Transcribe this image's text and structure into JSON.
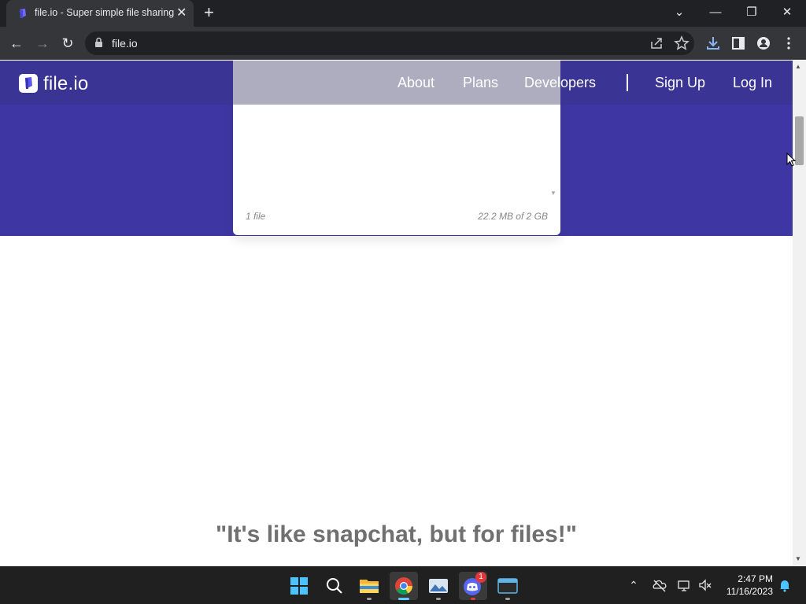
{
  "browser": {
    "tab": {
      "title": "file.io - Super simple file sharing",
      "close_glyph": "✕"
    },
    "new_tab_glyph": "+",
    "window_controls": {
      "tab_search_glyph": "⌄",
      "minimize_glyph": "—",
      "restore_glyph": "❐",
      "close_glyph": "✕"
    },
    "nav": {
      "back_glyph": "←",
      "forward_glyph": "→",
      "reload_glyph": "↻"
    },
    "address": {
      "url": "file.io"
    }
  },
  "site": {
    "brand": "file.io",
    "nav": {
      "about": "About",
      "plans": "Plans",
      "developers": "Developers",
      "signup": "Sign Up",
      "login": "Log In"
    },
    "upload_card": {
      "file_count": "1 file",
      "size_usage": "22.2 MB of 2 GB"
    },
    "quote": "\"It's like snapchat, but for files!\""
  },
  "taskbar": {
    "apps": [
      "windows-start",
      "search",
      "file-explorer",
      "chrome",
      "photos",
      "discord",
      "terminal"
    ],
    "discord_badge": "1",
    "time": "2:47 PM",
    "date": "11/16/2023"
  },
  "colors": {
    "hero": "#3e37a3",
    "nav": "#3a3494",
    "chrome_dark": "#202124",
    "chrome_mid": "#35363a"
  }
}
